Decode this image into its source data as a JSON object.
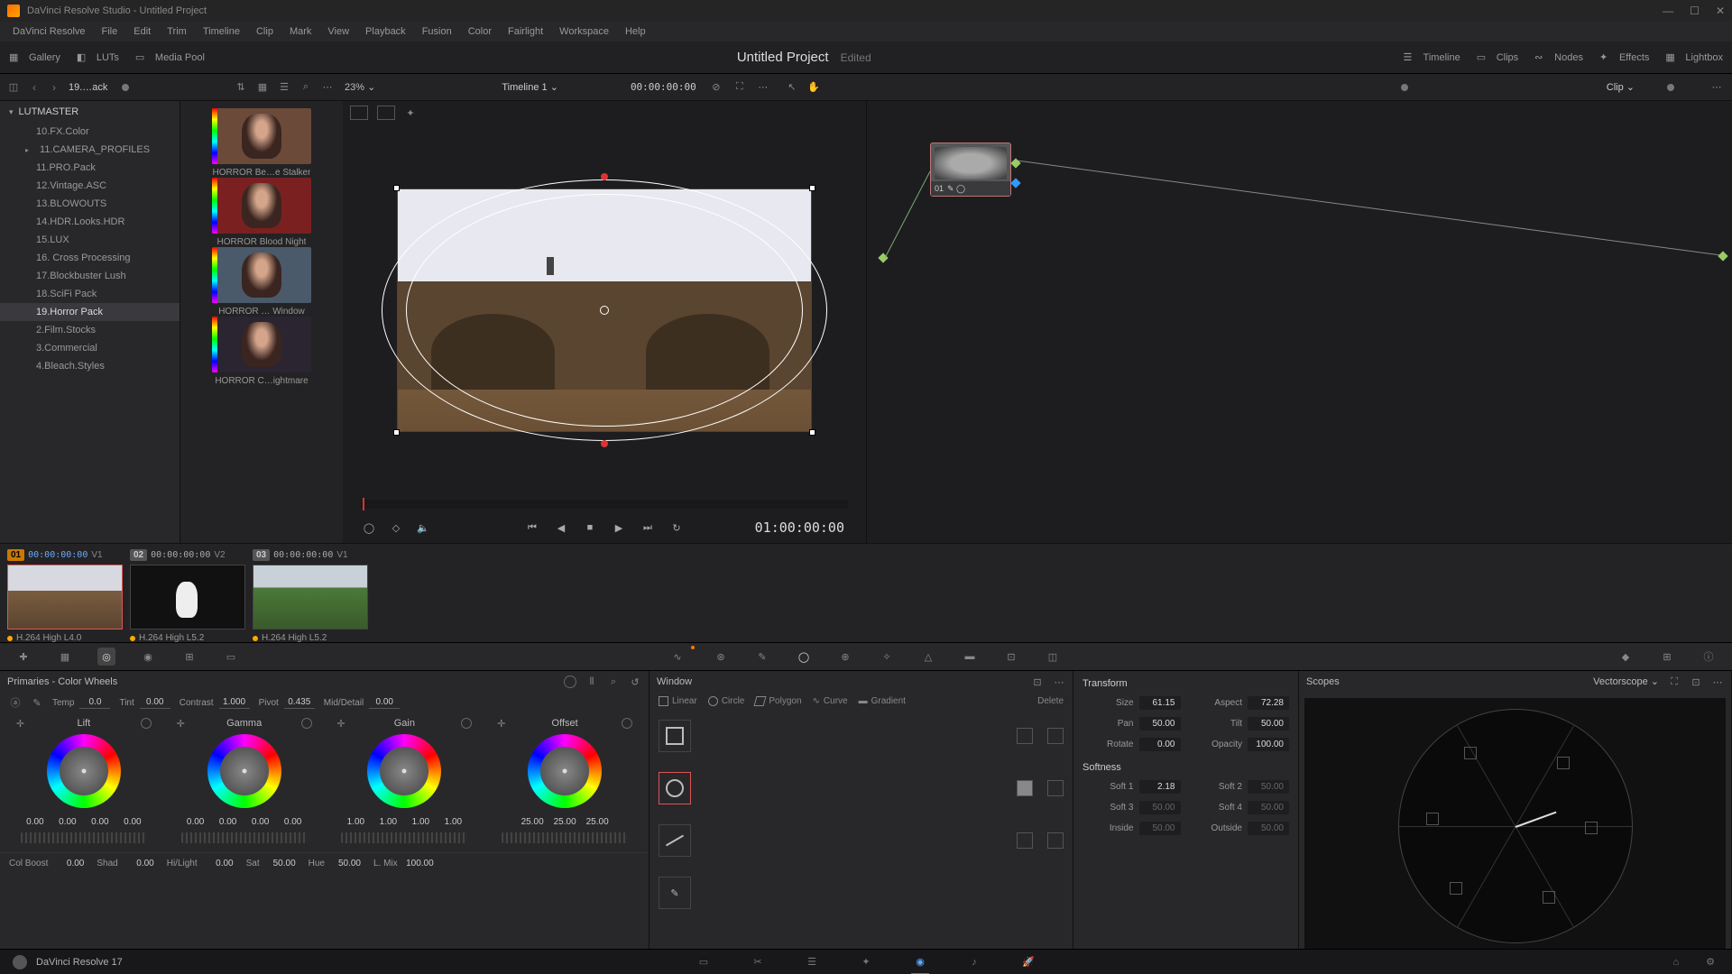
{
  "titlebar": {
    "text": "DaVinci Resolve Studio - Untitled Project"
  },
  "menu": [
    "DaVinci Resolve",
    "File",
    "Edit",
    "Trim",
    "Timeline",
    "Clip",
    "Mark",
    "View",
    "Playback",
    "Fusion",
    "Color",
    "Fairlight",
    "Workspace",
    "Help"
  ],
  "toolbar": {
    "gallery": "Gallery",
    "luts": "LUTs",
    "mediapool": "Media Pool",
    "project": "Untitled Project",
    "status": "Edited",
    "timeline": "Timeline",
    "clips": "Clips",
    "nodes": "Nodes",
    "effects": "Effects",
    "lightbox": "Lightbox"
  },
  "secbar": {
    "crumb": "19.…ack",
    "zoom": "23%",
    "timeline_name": "Timeline 1",
    "tc": "00:00:00:00",
    "clip_dd": "Clip"
  },
  "sidebar": {
    "root": "LUTMASTER",
    "items": [
      "10.FX.Color",
      "11.CAMERA_PROFILES",
      "11.PRO.Pack",
      "12.Vintage.ASC",
      "13.BLOWOUTS",
      "14.HDR.Looks.HDR",
      "15.LUX",
      "16. Cross Processing",
      "17.Blockbuster Lush",
      "18.SciFi Pack",
      "19.Horror Pack",
      "2.Film.Stocks",
      "3.Commercial",
      "4.Bleach.Styles"
    ],
    "selected_index": 10
  },
  "lut_thumbs": [
    "HORROR Be…e Stalker",
    "HORROR Blood Night",
    "HORROR … Window",
    "HORROR C…ightmare"
  ],
  "viewer": {
    "tc": "01:00:00:00"
  },
  "node": {
    "label": "01"
  },
  "clips": [
    {
      "num": "01",
      "tc": "00:00:00:00",
      "trk": "V1",
      "codec": "H.264 High L4.0",
      "selected": true
    },
    {
      "num": "02",
      "tc": "00:00:00:00",
      "trk": "V2",
      "codec": "H.264 High L5.2",
      "selected": false
    },
    {
      "num": "03",
      "tc": "00:00:00:00",
      "trk": "V1",
      "codec": "H.264 High L5.2",
      "selected": false
    }
  ],
  "primaries": {
    "title": "Primaries - Color Wheels",
    "top": {
      "temp_l": "Temp",
      "temp": "0.0",
      "tint_l": "Tint",
      "tint": "0.00",
      "contrast_l": "Contrast",
      "contrast": "1.000",
      "pivot_l": "Pivot",
      "pivot": "0.435",
      "md_l": "Mid/Detail",
      "md": "0.00"
    },
    "wheels": {
      "lift": {
        "name": "Lift",
        "vals": [
          "0.00",
          "0.00",
          "0.00",
          "0.00"
        ]
      },
      "gamma": {
        "name": "Gamma",
        "vals": [
          "0.00",
          "0.00",
          "0.00",
          "0.00"
        ]
      },
      "gain": {
        "name": "Gain",
        "vals": [
          "1.00",
          "1.00",
          "1.00",
          "1.00"
        ]
      },
      "offset": {
        "name": "Offset",
        "vals": [
          "25.00",
          "25.00",
          "25.00"
        ]
      }
    },
    "bottom": {
      "cb_l": "Col Boost",
      "cb": "0.00",
      "shad_l": "Shad",
      "shad": "0.00",
      "hl_l": "Hi/Light",
      "hl": "0.00",
      "sat_l": "Sat",
      "sat": "50.00",
      "hue_l": "Hue",
      "hue": "50.00",
      "lmix_l": "L. Mix",
      "lmix": "100.00"
    }
  },
  "window": {
    "title": "Window",
    "shapes": {
      "linear": "Linear",
      "circle": "Circle",
      "polygon": "Polygon",
      "curve": "Curve",
      "gradient": "Gradient",
      "delete": "Delete"
    }
  },
  "transform": {
    "title": "Transform",
    "size_l": "Size",
    "size": "61.15",
    "aspect_l": "Aspect",
    "aspect": "72.28",
    "pan_l": "Pan",
    "pan": "50.00",
    "tilt_l": "Tilt",
    "tilt": "50.00",
    "rotate_l": "Rotate",
    "rotate": "0.00",
    "opacity_l": "Opacity",
    "opacity": "100.00",
    "soft_title": "Softness",
    "s1_l": "Soft 1",
    "s1": "2.18",
    "s2_l": "Soft 2",
    "s2": "50.00",
    "s3_l": "Soft 3",
    "s3": "50.00",
    "s4_l": "Soft 4",
    "s4": "50.00",
    "in_l": "Inside",
    "in": "50.00",
    "out_l": "Outside",
    "out": "50.00"
  },
  "scopes": {
    "title": "Scopes",
    "type": "Vectorscope"
  },
  "footer": {
    "app": "DaVinci Resolve 17"
  }
}
